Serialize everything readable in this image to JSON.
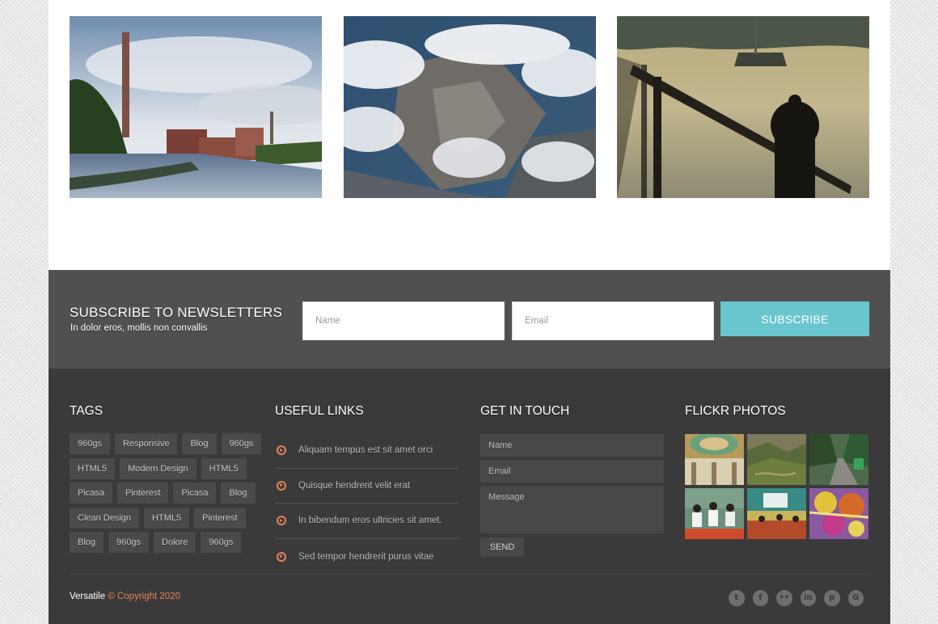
{
  "newsletter": {
    "title": "SUBSCRIBE TO NEWSLETTERS",
    "subtitle": "In dolor eros, mollis non convallis",
    "name_placeholder": "Name",
    "email_placeholder": "Email",
    "button_label": "SUBSCRIBE"
  },
  "footer": {
    "tags_title": "TAGS",
    "tag_rows": [
      [
        "960gs",
        "Responsive",
        "Blog",
        "960gs"
      ],
      [
        "HTML5",
        "Modern Design",
        "HTML5"
      ],
      [
        "Picasa",
        "Pinterest",
        "Picasa",
        "Blog"
      ],
      [
        "Clean Design",
        "HTML5",
        "Pinterest"
      ],
      [
        "Blog",
        "960gs",
        "Dolore",
        "960gs"
      ]
    ],
    "links_title": "USEFUL LINKS",
    "links": [
      "Aliquam tempus est sit amet orci",
      "Quisque hendrerit velit erat",
      "In bibendum eros ultricies sit amet.",
      "Sed tempor hendrerit purus vitae"
    ],
    "contact_title": "GET IN TOUCH",
    "contact_name_placeholder": "Name",
    "contact_email_placeholder": "Email",
    "contact_message_placeholder": "Message",
    "contact_send_label": "SEND",
    "flickr_title": "FLICKR PHOTOS",
    "copyright_brand": "Versatile",
    "copyright_text": "© Copyright 2020",
    "social_icons": [
      "twitter-icon",
      "facebook-icon",
      "flickr-icon",
      "linkedin-icon",
      "pinterest-icon",
      "google-plus-icon"
    ],
    "social_glyphs": [
      "t",
      "f",
      "••",
      "in",
      "p",
      "G"
    ]
  },
  "colors": {
    "accent": "#69c6ce",
    "link_icon": "#e2825b",
    "footer_bg": "#3a3a3a",
    "newsletter_bg": "#505050"
  }
}
